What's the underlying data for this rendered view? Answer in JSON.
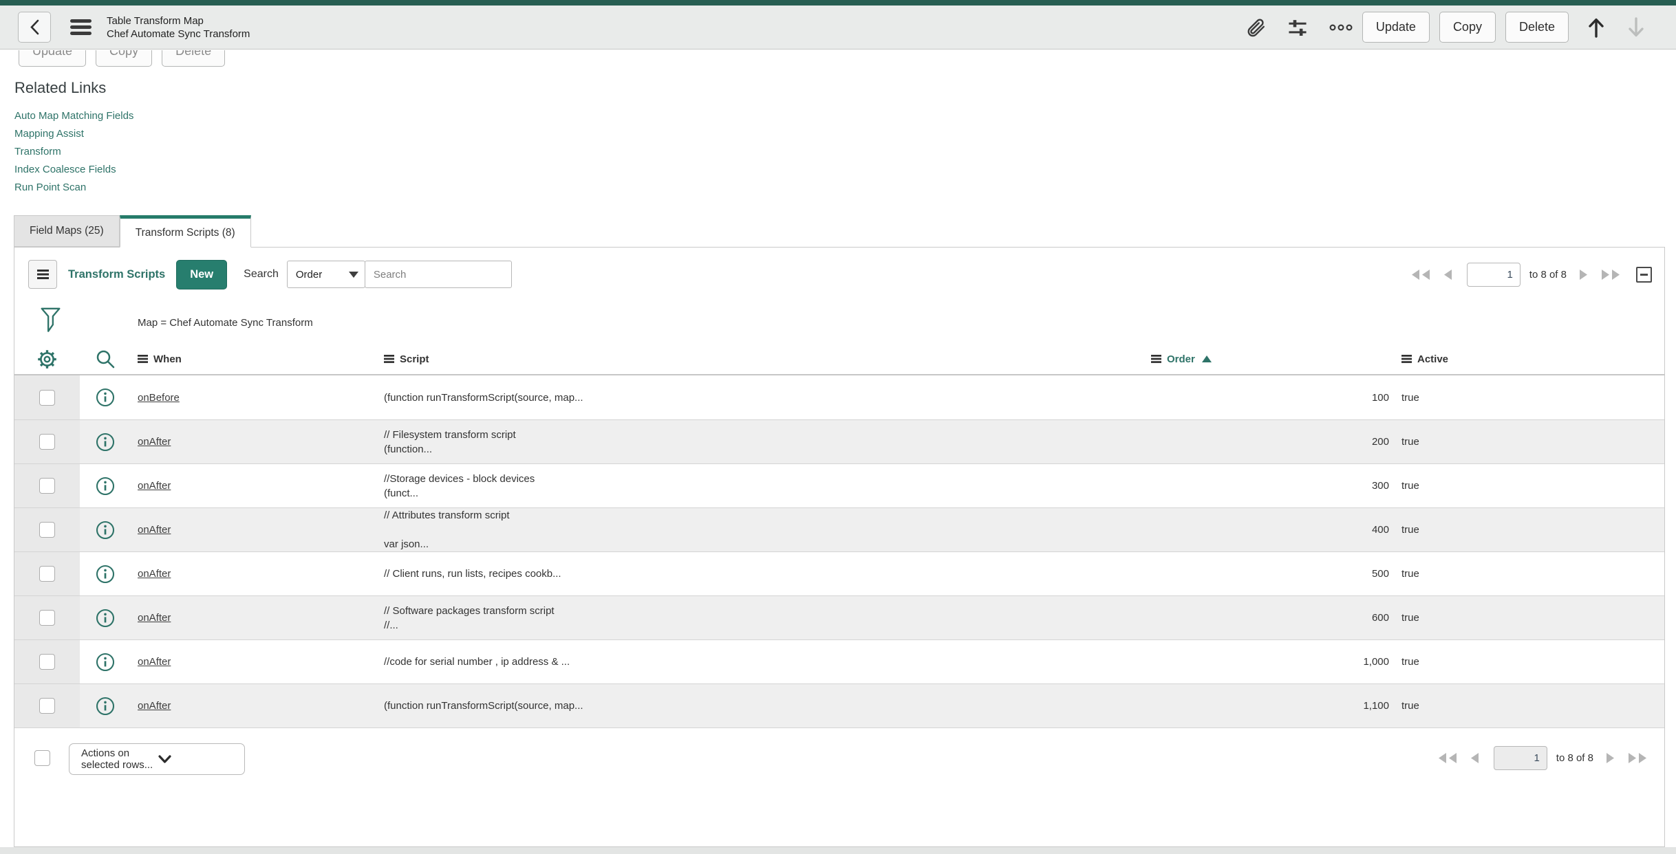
{
  "app_header": {
    "title_line1": "Table Transform Map",
    "title_line2": "Chef Automate Sync Transform",
    "buttons": {
      "update": "Update",
      "copy": "Copy",
      "delete": "Delete"
    }
  },
  "form_footer_buttons": {
    "update": "Update",
    "copy": "Copy",
    "delete": "Delete"
  },
  "related_links": {
    "heading": "Related Links",
    "links": [
      "Auto Map Matching Fields",
      "Mapping Assist",
      "Transform",
      "Index Coalesce Fields",
      "Run Point Scan"
    ]
  },
  "tabs": [
    {
      "label": "Field Maps (25)",
      "active": false
    },
    {
      "label": "Transform Scripts (8)",
      "active": true
    }
  ],
  "list": {
    "title": "Transform Scripts",
    "new_button": "New",
    "search_label": "Search",
    "search_field_selected": "Order",
    "search_placeholder": "Search",
    "filter_text": "Map = Chef Automate Sync Transform",
    "pagination": {
      "page": "1",
      "range": "to 8 of 8"
    },
    "columns": {
      "when": "When",
      "script": "Script",
      "order": "Order",
      "active": "Active"
    },
    "sorted_column": "Order",
    "sort_direction": "ascending",
    "rows": [
      {
        "when": "onBefore",
        "script_lines": [
          "(function runTransformScript(source, map..."
        ],
        "order": "100",
        "active": "true"
      },
      {
        "when": "onAfter",
        "script_lines": [
          "// Filesystem transform script",
          "(function..."
        ],
        "order": "200",
        "active": "true"
      },
      {
        "when": "onAfter",
        "script_lines": [
          "//Storage devices - block devices",
          "(funct..."
        ],
        "order": "300",
        "active": "true"
      },
      {
        "when": "onAfter",
        "script_lines": [
          "// Attributes transform script",
          "",
          "var json..."
        ],
        "order": "400",
        "active": "true"
      },
      {
        "when": "onAfter",
        "script_lines": [
          "// Client runs, run lists, recipes cookb..."
        ],
        "order": "500",
        "active": "true"
      },
      {
        "when": "onAfter",
        "script_lines": [
          "// Software packages transform script",
          "//..."
        ],
        "order": "600",
        "active": "true"
      },
      {
        "when": "onAfter",
        "script_lines": [
          "//code for serial number , ip address & ..."
        ],
        "order": "1,000",
        "active": "true"
      },
      {
        "when": "onAfter",
        "script_lines": [
          "(function runTransformScript(source, map..."
        ],
        "order": "1,100",
        "active": "true"
      }
    ],
    "actions_select": "Actions on selected rows..."
  },
  "colors": {
    "top_strip": "#275e52",
    "accent_teal": "#277e6e",
    "link_teal": "#2e7368",
    "header_bar_bg": "#e9ebea",
    "alt_row_bg": "#efefef"
  }
}
